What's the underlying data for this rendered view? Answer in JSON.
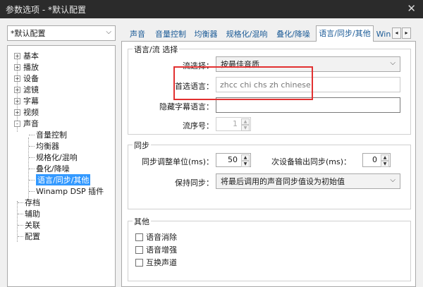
{
  "window": {
    "title": "参数选项 - *默认配置",
    "close_glyph": "✕"
  },
  "preset": {
    "value": "*默认配置"
  },
  "tree": {
    "items": [
      {
        "label": "基本",
        "expander": "+"
      },
      {
        "label": "播放",
        "expander": "+"
      },
      {
        "label": "设备",
        "expander": "+"
      },
      {
        "label": "滤镜",
        "expander": "+"
      },
      {
        "label": "字幕",
        "expander": "+"
      },
      {
        "label": "视频",
        "expander": "+"
      },
      {
        "label": "声音",
        "expander": "-"
      },
      {
        "label": "音量控制"
      },
      {
        "label": "均衡器"
      },
      {
        "label": "规格化/混响"
      },
      {
        "label": "叠化/降噪"
      },
      {
        "label": "语言/同步/其他",
        "selected": true
      },
      {
        "label": "Winamp DSP 插件"
      },
      {
        "label": "存档"
      },
      {
        "label": "辅助"
      },
      {
        "label": "关联"
      },
      {
        "label": "配置"
      }
    ]
  },
  "tabs": [
    {
      "label": "声音"
    },
    {
      "label": "音量控制"
    },
    {
      "label": "均衡器"
    },
    {
      "label": "规格化/混响"
    },
    {
      "label": "叠化/降噪"
    },
    {
      "label": "语言/同步/其他",
      "active": true
    },
    {
      "label": "Win"
    }
  ],
  "tab_scroll": {
    "left": "◂",
    "right": "▸"
  },
  "language_group": {
    "title": "语言/流 选择",
    "stream_select": {
      "label": "流选择：",
      "value": "按最佳音质"
    },
    "preferred_lang": {
      "label": "首选语言：",
      "value": "zhcc chi chs zh chinese"
    },
    "hidden_sub_lang": {
      "label": "隐藏字幕语言：",
      "value": ""
    },
    "stream_number": {
      "label": "流序号：",
      "value": "1"
    }
  },
  "sync_group": {
    "title": "同步",
    "sync_adjust": {
      "label": "同步调整单位(ms)：",
      "value": "50"
    },
    "secondary_sync": {
      "label": "次设备输出同步(ms)：",
      "value": "0"
    },
    "keep_sync": {
      "label": "保持同步：",
      "value": "将最后调用的声音同步值设为初始值"
    }
  },
  "other_group": {
    "title": "其他",
    "checkboxes": [
      {
        "label": "语音消除"
      },
      {
        "label": "语音增强"
      },
      {
        "label": "互换声道"
      }
    ]
  },
  "icons": {
    "dropdown": "chevron-down-icon",
    "spin_up": "▲",
    "spin_down": "▼",
    "chevron": "⌵"
  },
  "colors": {
    "titlebar": "#2b2b2b",
    "selection": "#3399ff",
    "highlight": "#e23030",
    "tab_text": "#1a5a96"
  }
}
